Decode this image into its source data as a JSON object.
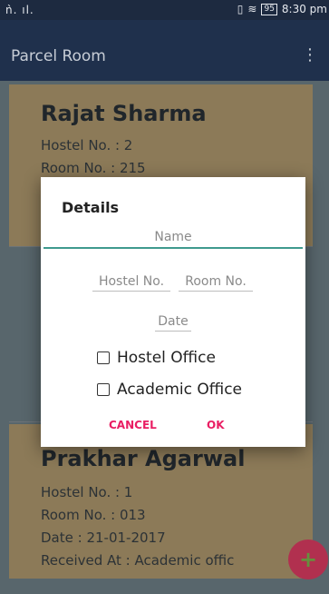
{
  "status_bar": {
    "signal": "༝༝.༝༝.",
    "battery": "95",
    "time": "8:30 pm"
  },
  "app_bar": {
    "title": "Parcel Room",
    "menu_icon": "more-vert-icon"
  },
  "cards": [
    {
      "name": "Rajat Sharma",
      "lines": [
        "Hostel No. : 2",
        "Room No. : 215"
      ]
    },
    {
      "name": "Prakhar Agarwal",
      "lines": [
        "Hostel No. : 1",
        "Room No. : 013",
        "Date : 21-01-2017",
        "Received At : Academic offic"
      ]
    }
  ],
  "dialog": {
    "title": "Details",
    "name_placeholder": "Name",
    "hostel_placeholder": "Hostel No.",
    "room_placeholder": "Room No.",
    "date_placeholder": "Date",
    "checkbox_hostel_office": "Hostel Office",
    "checkbox_academic_office": "Academic Office",
    "cancel_label": "CANCEL",
    "ok_label": "OK"
  },
  "fab": {
    "icon": "add-icon",
    "symbol": "+"
  },
  "colors": {
    "accent": "#e91e63",
    "field_focus": "#3f9a8e",
    "app_bar": "#1f304c",
    "card": "#8c7a58",
    "fab": "#b1304f"
  }
}
